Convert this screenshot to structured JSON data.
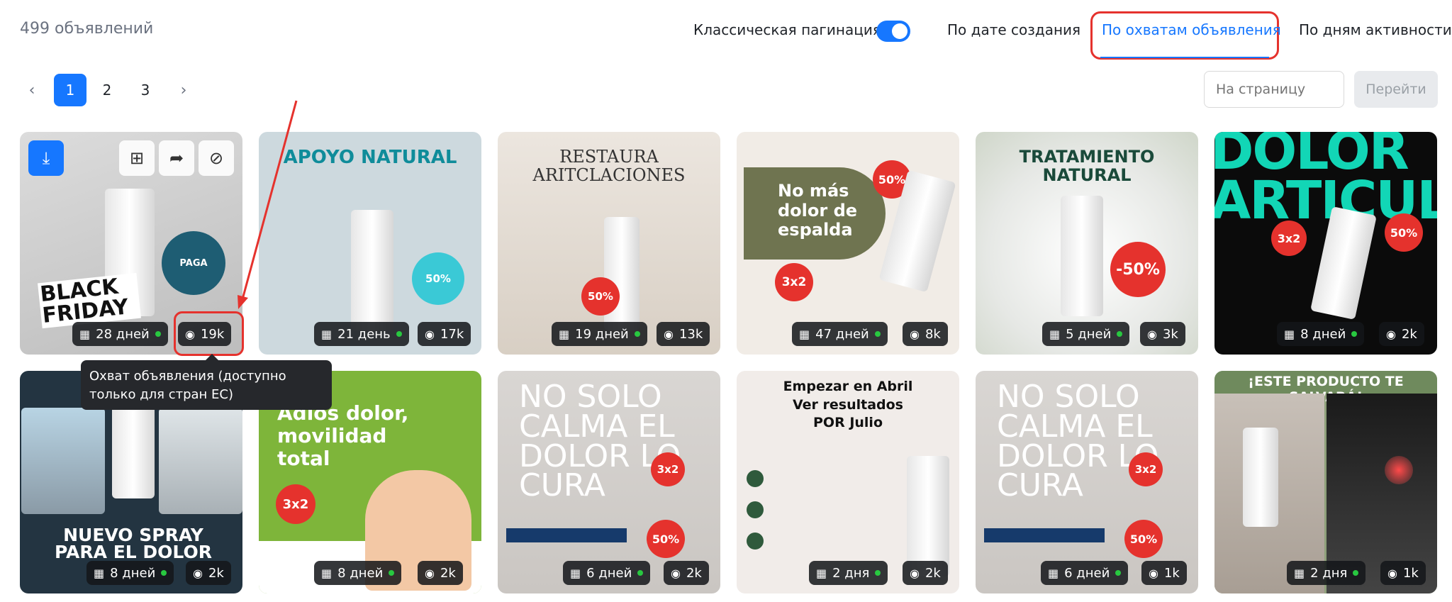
{
  "header": {
    "count": "499 объявлений",
    "pagination_toggle_label": "Классическая пагинация",
    "sort_options": [
      "По дате создания",
      "По охватам объявления",
      "По дням активности"
    ],
    "active_sort": "По охватам объявления"
  },
  "pagination": {
    "pages": [
      "1",
      "2",
      "3"
    ],
    "current": "1",
    "goto_placeholder": "На страницу",
    "goto_button": "Перейти"
  },
  "tooltip": "Охват объявления (доступно только для стран ЕС)",
  "cards": [
    {
      "title": "BLACK FRIDAY",
      "days": "28 дней",
      "views": "19k",
      "bg": "#cfcfcf"
    },
    {
      "title": "APOYO NATURAL",
      "days": "21 день",
      "views": "17k",
      "bg": "#cdd9de"
    },
    {
      "title": "RESTAURA ARITCLACIONES",
      "days": "19 дней",
      "views": "13k",
      "bg": "#e9e2da"
    },
    {
      "title": "No más dolor de espalda",
      "days": "47 дней",
      "views": "8k",
      "bg": "#6f7450"
    },
    {
      "title": "TRATAMIENTO NATURAL",
      "days": "5 дней",
      "views": "3k",
      "bg": "#e9eae8"
    },
    {
      "title": "DOLOR ARTICULAR",
      "days": "8 дней",
      "views": "2k",
      "bg": "#0bd3b6"
    },
    {
      "title": "NUEVO SPRAY PARA EL DOLOR",
      "days": "8 дней",
      "views": "2k",
      "bg": "#233441"
    },
    {
      "title": "Adiós dolor, movilidad total",
      "days": "8 дней",
      "views": "2k",
      "bg": "#7eb53a"
    },
    {
      "title": "NO SOLO CALMA EL DOLOR LO CURA",
      "days": "6 дней",
      "views": "2k",
      "bg": "#dcd9d6"
    },
    {
      "title": "Empezar en Abril Ver resultados POR Julio",
      "days": "2 дня",
      "views": "2k",
      "bg": "#efe9e7"
    },
    {
      "title": "NO SOLO CALMA EL DOLOR LO CURA",
      "days": "6 дней",
      "views": "1k",
      "bg": "#dcd9d6"
    },
    {
      "title": "¡ESTE PRODUCTO TE SALVARÁ!",
      "days": "2 дня",
      "views": "1k",
      "bg": "#8ea07a"
    }
  ]
}
